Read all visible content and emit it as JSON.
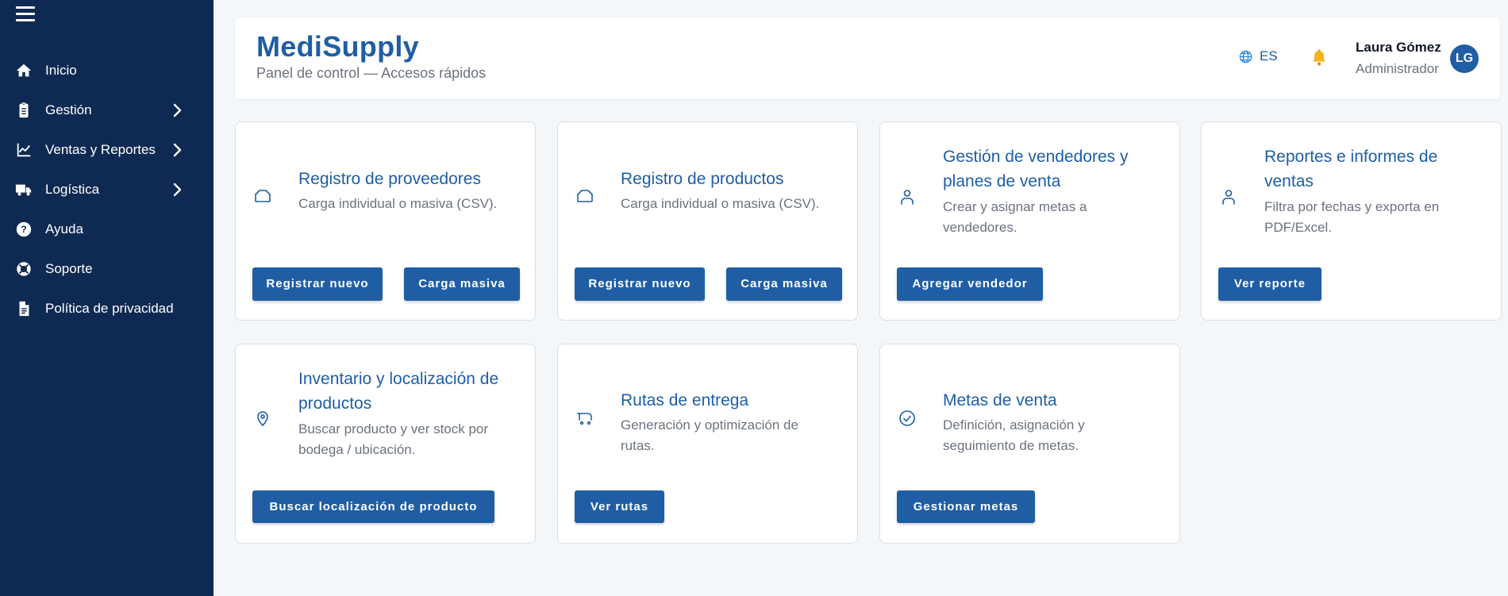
{
  "sidebar": {
    "items": [
      {
        "label": "Inicio",
        "icon": "home-icon",
        "has_submenu": false
      },
      {
        "label": "Gestión",
        "icon": "clipboard-icon",
        "has_submenu": true
      },
      {
        "label": "Ventas y Reportes",
        "icon": "chart-line-icon",
        "has_submenu": true
      },
      {
        "label": "Logística",
        "icon": "truck-icon",
        "has_submenu": true
      },
      {
        "label": "Ayuda",
        "icon": "help-icon",
        "has_submenu": false
      },
      {
        "label": "Soporte",
        "icon": "lifebuoy-icon",
        "has_submenu": false
      },
      {
        "label": "Política de privacidad",
        "icon": "document-icon",
        "has_submenu": false
      }
    ]
  },
  "header": {
    "title": "MediSupply",
    "subtitle": "Panel de control — Accesos rápidos",
    "language": "ES",
    "user_name": "Laura Gómez",
    "user_role": "Administrador",
    "avatar_initials": "LG"
  },
  "cards": [
    {
      "title": "Registro de proveedores",
      "description": "Carga individual o masiva (CSV).",
      "icon": "box-icon",
      "buttons": [
        "Registrar nuevo",
        "Carga masiva"
      ]
    },
    {
      "title": "Registro de productos",
      "description": "Carga individual o masiva (CSV).",
      "icon": "box-icon",
      "buttons": [
        "Registrar nuevo",
        "Carga masiva"
      ]
    },
    {
      "title": "Gestión de vendedores y planes de venta",
      "description": "Crear y asignar metas a vendedores.",
      "icon": "person-icon",
      "buttons": [
        "Agregar vendedor"
      ]
    },
    {
      "title": "Reportes e informes de ventas",
      "description": "Filtra por fechas y exporta en PDF/Excel.",
      "icon": "person-icon",
      "buttons": [
        "Ver reporte"
      ]
    },
    {
      "title": "Inventario y localización de productos",
      "description": "Buscar producto y ver stock por bodega / ubicación.",
      "icon": "location-pin-icon",
      "buttons": [
        "Buscar localización de producto"
      ]
    },
    {
      "title": "Rutas de entrega",
      "description": "Generación y optimización de rutas.",
      "icon": "cart-icon",
      "buttons": [
        "Ver rutas"
      ]
    },
    {
      "title": "Metas de venta",
      "description": "Definición, asignación y seguimiento de metas.",
      "icon": "check-circle-icon",
      "buttons": [
        "Gestionar metas"
      ]
    }
  ],
  "colors": {
    "sidebar_bg": "#0f2a52",
    "accent": "#1f5ea5",
    "page_bg": "#f4f7fa"
  }
}
